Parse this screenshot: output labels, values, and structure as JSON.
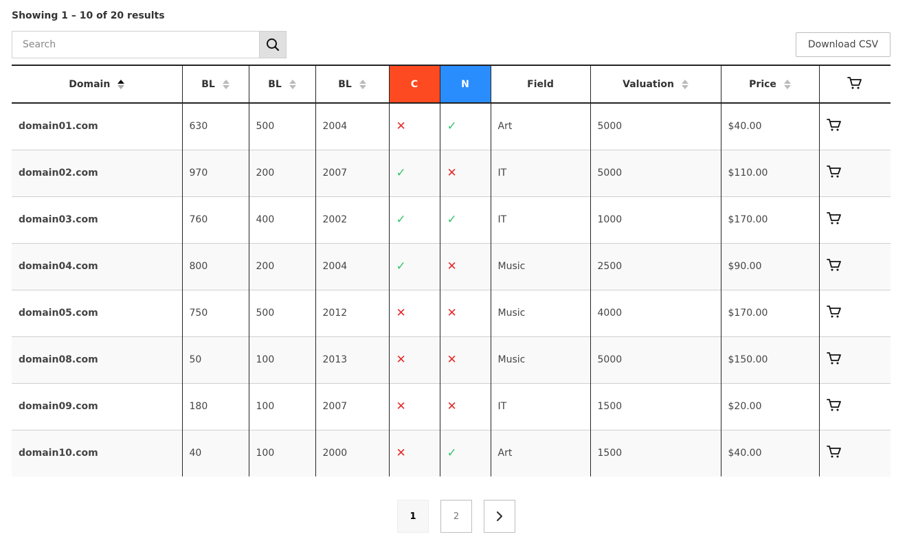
{
  "results_text": "Showing 1 – 10 of 20 results",
  "search": {
    "placeholder": "Search",
    "value": ""
  },
  "download_label": "Download CSV",
  "columns": [
    "Domain",
    "BL",
    "BL",
    "BL",
    "C",
    "N",
    "Field",
    "Valuation",
    "Price"
  ],
  "colors": {
    "c_header": "#fe4a21",
    "n_header": "#2a8dfd",
    "yes": "#35c46a",
    "no": "#e52b2b"
  },
  "rows": [
    {
      "domain": "domain01.com",
      "bl1": "630",
      "bl2": "500",
      "bl3": "2004",
      "c": false,
      "n": true,
      "field": "Art",
      "valuation": "5000",
      "price": "$40.00"
    },
    {
      "domain": "domain02.com",
      "bl1": "970",
      "bl2": "200",
      "bl3": "2007",
      "c": true,
      "n": false,
      "field": "IT",
      "valuation": "5000",
      "price": "$110.00"
    },
    {
      "domain": "domain03.com",
      "bl1": "760",
      "bl2": "400",
      "bl3": "2002",
      "c": true,
      "n": true,
      "field": "IT",
      "valuation": "1000",
      "price": "$170.00"
    },
    {
      "domain": "domain04.com",
      "bl1": "800",
      "bl2": "200",
      "bl3": "2004",
      "c": true,
      "n": false,
      "field": "Music",
      "valuation": "2500",
      "price": "$90.00"
    },
    {
      "domain": "domain05.com",
      "bl1": "750",
      "bl2": "500",
      "bl3": "2012",
      "c": false,
      "n": false,
      "field": "Music",
      "valuation": "4000",
      "price": "$170.00"
    },
    {
      "domain": "domain08.com",
      "bl1": "50",
      "bl2": "100",
      "bl3": "2013",
      "c": false,
      "n": false,
      "field": "Music",
      "valuation": "5000",
      "price": "$150.00"
    },
    {
      "domain": "domain09.com",
      "bl1": "180",
      "bl2": "100",
      "bl3": "2007",
      "c": false,
      "n": false,
      "field": "IT",
      "valuation": "1500",
      "price": "$20.00"
    },
    {
      "domain": "domain10.com",
      "bl1": "40",
      "bl2": "100",
      "bl3": "2000",
      "c": false,
      "n": true,
      "field": "Art",
      "valuation": "1500",
      "price": "$40.00"
    }
  ],
  "pagination": {
    "pages": [
      "1",
      "2"
    ],
    "current": "1"
  }
}
